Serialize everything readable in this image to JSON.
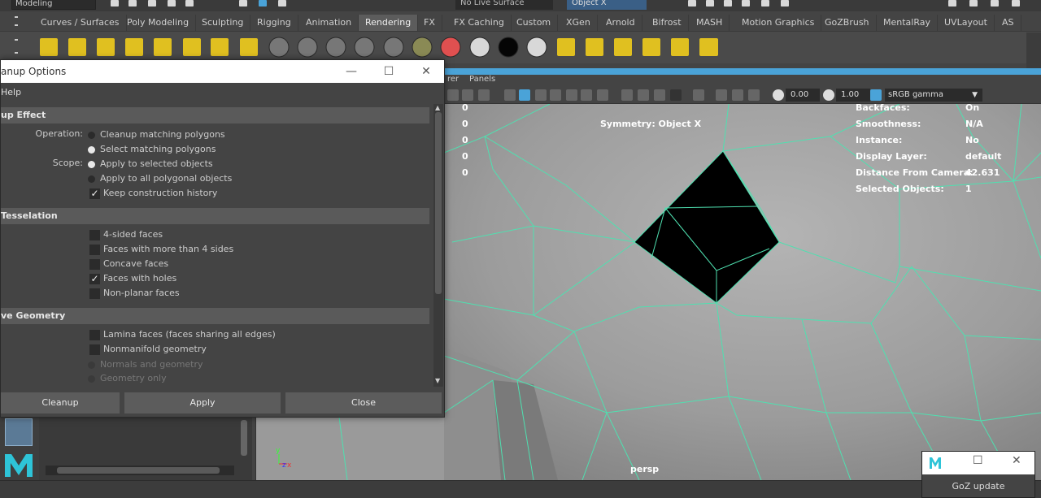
{
  "toolbar": {
    "mode": "Modeling",
    "live_surface": "No Live Surface",
    "symmetry_select": "Object X"
  },
  "shelf_tabs": [
    {
      "label": "Curves / Surfaces",
      "active": false
    },
    {
      "label": "Poly Modeling",
      "active": false
    },
    {
      "label": "Sculpting",
      "active": false
    },
    {
      "label": "Rigging",
      "active": false
    },
    {
      "label": "Animation",
      "active": false
    },
    {
      "label": "Rendering",
      "active": true
    },
    {
      "label": "FX",
      "active": false
    },
    {
      "label": "FX Caching",
      "active": false
    },
    {
      "label": "Custom",
      "active": false
    },
    {
      "label": "XGen",
      "active": false
    },
    {
      "label": "Arnold",
      "active": false
    },
    {
      "label": "Bifrost",
      "active": false
    },
    {
      "label": "MASH",
      "active": false
    },
    {
      "label": "Motion Graphics",
      "active": false
    },
    {
      "label": "GoZBrush",
      "active": false
    },
    {
      "label": "MentalRay",
      "active": false
    },
    {
      "label": "UVLayout",
      "active": false
    },
    {
      "label": "AS",
      "active": false
    }
  ],
  "shelf_icons": [
    "point-light-icon",
    "directional-light-icon",
    "spot-light-icon",
    "ambient-light-icon",
    "area-light-icon",
    "volume-light-icon",
    "camera-icon",
    "camera-aim-icon",
    "mat-sphere-icon",
    "mat-sphere-icon",
    "mat-sphere-icon",
    "mat-sphere-icon",
    "mat-sphere-icon",
    "mat-stripe-icon",
    "mat-heat-icon",
    "white-sphere-icon",
    "black-sphere-icon",
    "white-sphere-icon",
    "render-view-icon",
    "render-icon",
    "ipr-render-icon",
    "render-settings-icon",
    "hypershade-icon",
    "batch-render-icon",
    "render-target-icon"
  ],
  "viewport_menu": {
    "renderer": "rer",
    "panels": "Panels"
  },
  "viewport_toolbar": {
    "exposure": "0.00",
    "gamma": "1.00",
    "color_space": "sRGB gamma"
  },
  "hud": {
    "counts": [
      "0",
      "0",
      "0",
      "0",
      "0"
    ],
    "symmetry": "Symmetry: Object X",
    "labels": [
      "Backfaces:",
      "Smoothness:",
      "Instance:",
      "Display Layer:",
      "Distance From Camera:",
      "Selected Objects:"
    ],
    "values": [
      "On",
      "N/A",
      "No",
      "default",
      "42.631",
      "1"
    ],
    "camera": "persp"
  },
  "dialog": {
    "title": "anup Options",
    "menu_help": "Help",
    "sections": {
      "effect": "up Effect",
      "tesselation": " Tesselation",
      "geometry": "ve Geometry"
    },
    "operation_label": "Operation:",
    "operation_options": [
      "Cleanup matching polygons",
      "Select matching polygons"
    ],
    "scope_label": "Scope:",
    "scope_options": [
      "Apply to selected objects",
      "Apply to all polygonal objects"
    ],
    "keep_history": "Keep construction history",
    "tess_options": [
      "4-sided faces",
      "Faces with more than 4 sides",
      "Concave faces",
      "Faces with holes",
      "Non-planar faces"
    ],
    "geom_options": [
      "Lamina faces (faces sharing all edges)",
      "Nonmanifold geometry"
    ],
    "geom_sub_options": [
      "Normals and geometry",
      "Geometry only"
    ],
    "buttons": {
      "cleanup": "Cleanup",
      "apply": "Apply",
      "close": "Close"
    }
  },
  "goz_popup": {
    "text": "GoZ update"
  },
  "colors": {
    "accent": "#4aa3d8",
    "wire": "#4fe0b0",
    "viewport_bg": "#9a9a9a"
  }
}
